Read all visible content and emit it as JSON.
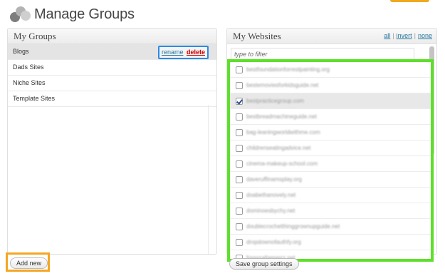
{
  "page": {
    "title": "Manage Groups"
  },
  "colors": {
    "accent_orange": "#f5a623",
    "highlight_green": "#5ee02a",
    "highlight_blue": "#2a8be8",
    "link": "#21759b",
    "delete": "#cc0000"
  },
  "groups_panel": {
    "title": "My Groups",
    "rename_label": "rename",
    "delete_label": "delete",
    "items": [
      {
        "label": "Blogs",
        "selected": true
      },
      {
        "label": "Dads Sites",
        "selected": false
      },
      {
        "label": "Niche Sites",
        "selected": false
      },
      {
        "label": "Template Sites",
        "selected": false
      }
    ],
    "add_button": "Add new"
  },
  "websites_panel": {
    "title": "My Websites",
    "links": {
      "all": "all",
      "invert": "invert",
      "none": "none"
    },
    "filter_placeholder": "type to filter",
    "sites": [
      {
        "name": "bestfoundationforrestpainting.org",
        "checked": false
      },
      {
        "name": "bestemoviesforkidsguide.net",
        "checked": false
      },
      {
        "name": "bestpracticegroup.com",
        "checked": true
      },
      {
        "name": "bestbreadmachineguide.net",
        "checked": false
      },
      {
        "name": "bag-leaningworldwithme.com",
        "checked": false
      },
      {
        "name": "childrenseatingadvice.net",
        "checked": false
      },
      {
        "name": "cinema-makeup-school.com",
        "checked": false
      },
      {
        "name": "daveruffinamsplay.org",
        "checked": false
      },
      {
        "name": "doabethanovely.net",
        "checked": false
      },
      {
        "name": "dominoesbychy.net",
        "checked": false
      },
      {
        "name": "doublecrochetthinggrownupguide.net",
        "checked": false
      },
      {
        "name": "dropdownofauthfy.org",
        "checked": false
      },
      {
        "name": "forexsaltamerrz.net",
        "checked": false
      }
    ],
    "save_button": "Save group settings"
  }
}
